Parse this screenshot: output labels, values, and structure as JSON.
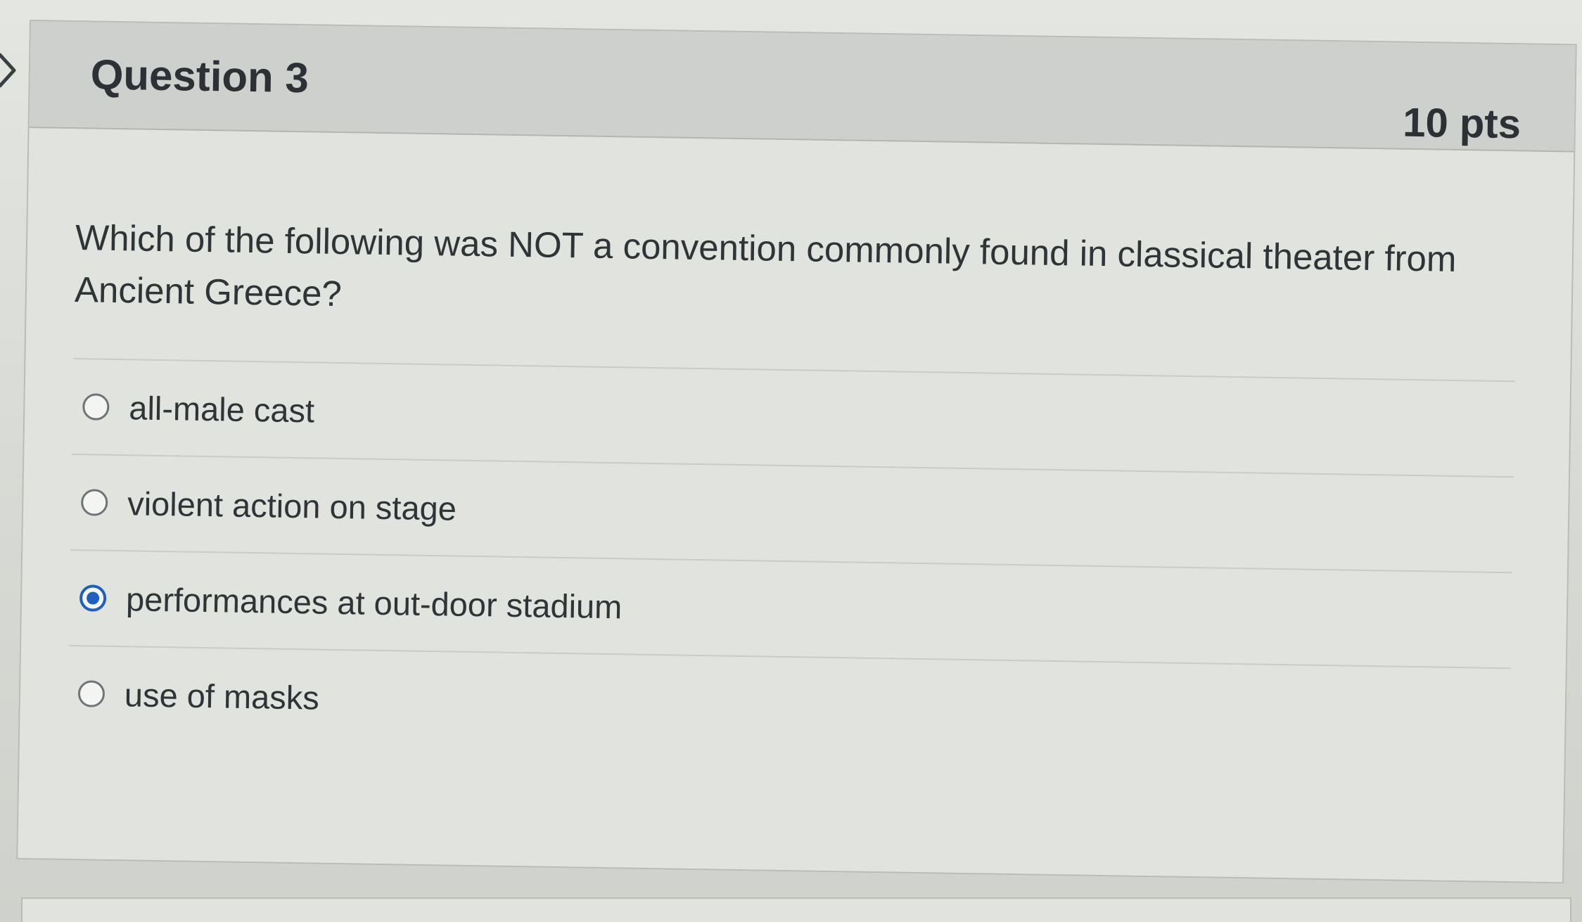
{
  "question": {
    "title": "Question 3",
    "points": "10 pts",
    "text": "Which of the following was NOT a convention commonly found in classical theater from Ancient Greece?",
    "answers": [
      {
        "label": "all-male cast",
        "selected": false
      },
      {
        "label": "violent action on stage",
        "selected": false
      },
      {
        "label": "performances at out-door stadium",
        "selected": true
      },
      {
        "label": "use of masks",
        "selected": false
      }
    ]
  },
  "colors": {
    "selected_radio": "#1f5fbf",
    "header_background": "#cdd0cc",
    "card_background": "#e1e3df"
  },
  "icons": {
    "nav": "chevron-right-icon"
  }
}
